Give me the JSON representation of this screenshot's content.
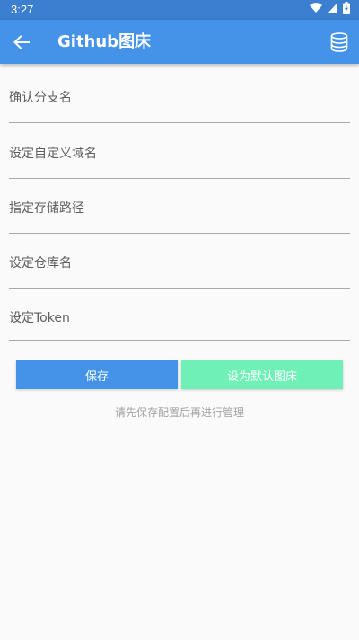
{
  "status_bar": {
    "time": "3:27",
    "icons": [
      "wifi-icon",
      "cell-signal-icon",
      "battery-charging-icon"
    ]
  },
  "app_bar": {
    "back_icon": "arrow-back-icon",
    "title": "Github图床",
    "action_icon": "database-icon",
    "color": "#4593e9"
  },
  "form": {
    "fields": [
      {
        "placeholder": "确认分支名",
        "value": ""
      },
      {
        "placeholder": "设定自定义域名",
        "value": ""
      },
      {
        "placeholder": "指定存储路径",
        "value": ""
      },
      {
        "placeholder": "设定仓库名",
        "value": ""
      },
      {
        "placeholder": "设定Token",
        "value": ""
      }
    ]
  },
  "buttons": {
    "save_label": "保存",
    "set_default_label": "设为默认图床",
    "save_color": "#4593e9",
    "set_default_color": "#6ef0b6"
  },
  "hint": "请先保存配置后再进行管理"
}
